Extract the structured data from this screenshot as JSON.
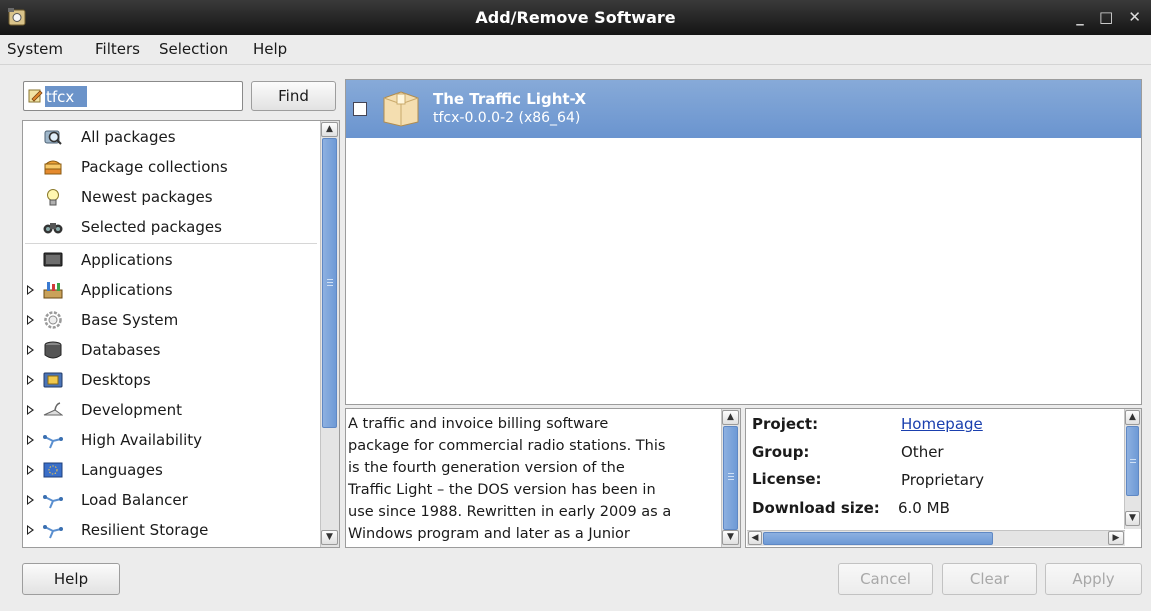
{
  "window": {
    "title": "Add/Remove Software",
    "controls": [
      "_",
      "□",
      "✕"
    ]
  },
  "menu": {
    "items": [
      "System",
      "Filters",
      "Selection",
      "Help"
    ]
  },
  "search": {
    "value": "tfcx",
    "find_label": "Find"
  },
  "sidebar": {
    "groups": [
      {
        "label": "All packages",
        "icon": "magnifier-icon"
      },
      {
        "label": "Package collections",
        "icon": "package-collection-icon"
      },
      {
        "label": "Newest packages",
        "icon": "lightbulb-icon"
      },
      {
        "label": "Selected packages",
        "icon": "binoculars-icon"
      }
    ],
    "categories": [
      {
        "label": "Applications",
        "icon": "monitor-icon",
        "expandable": false
      },
      {
        "label": "Applications",
        "icon": "applications-icon",
        "expandable": true
      },
      {
        "label": "Base System",
        "icon": "gear-icon",
        "expandable": true
      },
      {
        "label": "Databases",
        "icon": "database-icon",
        "expandable": true
      },
      {
        "label": "Desktops",
        "icon": "desktop-icon",
        "expandable": true
      },
      {
        "label": "Development",
        "icon": "development-icon",
        "expandable": true
      },
      {
        "label": "High Availability",
        "icon": "cluster-icon",
        "expandable": true
      },
      {
        "label": "Languages",
        "icon": "flag-icon",
        "expandable": true
      },
      {
        "label": "Load Balancer",
        "icon": "cluster-icon",
        "expandable": true
      },
      {
        "label": "Resilient Storage",
        "icon": "cluster-icon",
        "expandable": true
      }
    ]
  },
  "packages": [
    {
      "name": "The Traffic Light-X",
      "id": "tfcx-0.0.0-2 (x86_64)",
      "selected": true,
      "checked": false
    }
  ],
  "description": {
    "lines": [
      "A traffic and invoice billing software",
      "package for commercial radio stations. This",
      "is the fourth generation version of the",
      "Traffic Light – the DOS version has been in",
      "use since 1988. Rewritten in early 2009 as a",
      "Windows program and later as a Junior"
    ]
  },
  "details": {
    "project_label": "Project:",
    "project_value": "Homepage",
    "group_label": "Group:",
    "group_value": "Other",
    "license_label": "License:",
    "license_value": "Proprietary",
    "size_label": "Download size:",
    "size_value": "6.0 MB"
  },
  "buttons": {
    "help": "Help",
    "cancel": "Cancel",
    "clear": "Clear",
    "apply": "Apply"
  },
  "colors": {
    "selection": "#7aa0d4",
    "titlebar": "#1e1e1e",
    "link": "#1a3fae"
  }
}
